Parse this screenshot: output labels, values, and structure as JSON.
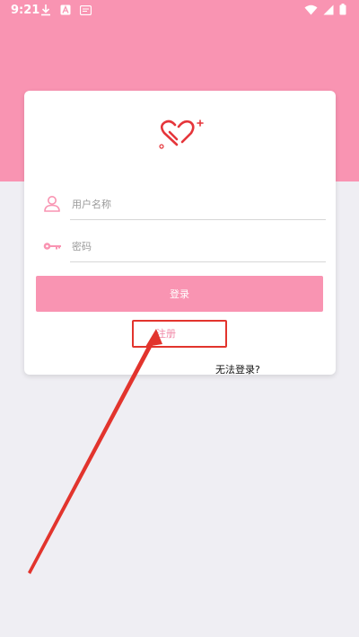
{
  "status_bar": {
    "time": "9:21",
    "left_icons": [
      "download-icon",
      "a-badge-icon",
      "cast-icon"
    ],
    "right_icons": [
      "wifi-icon",
      "signal-icon",
      "battery-icon"
    ]
  },
  "login": {
    "logo_icon": "heart-logo-icon",
    "username_placeholder": "用户名称",
    "password_placeholder": "密码",
    "login_label": "登录",
    "register_label": "注册",
    "forgot_label": "无法登录?"
  },
  "colors": {
    "brand_pink": "#f994b2",
    "annotation_red": "#e2342d",
    "background": "#efeef3"
  }
}
